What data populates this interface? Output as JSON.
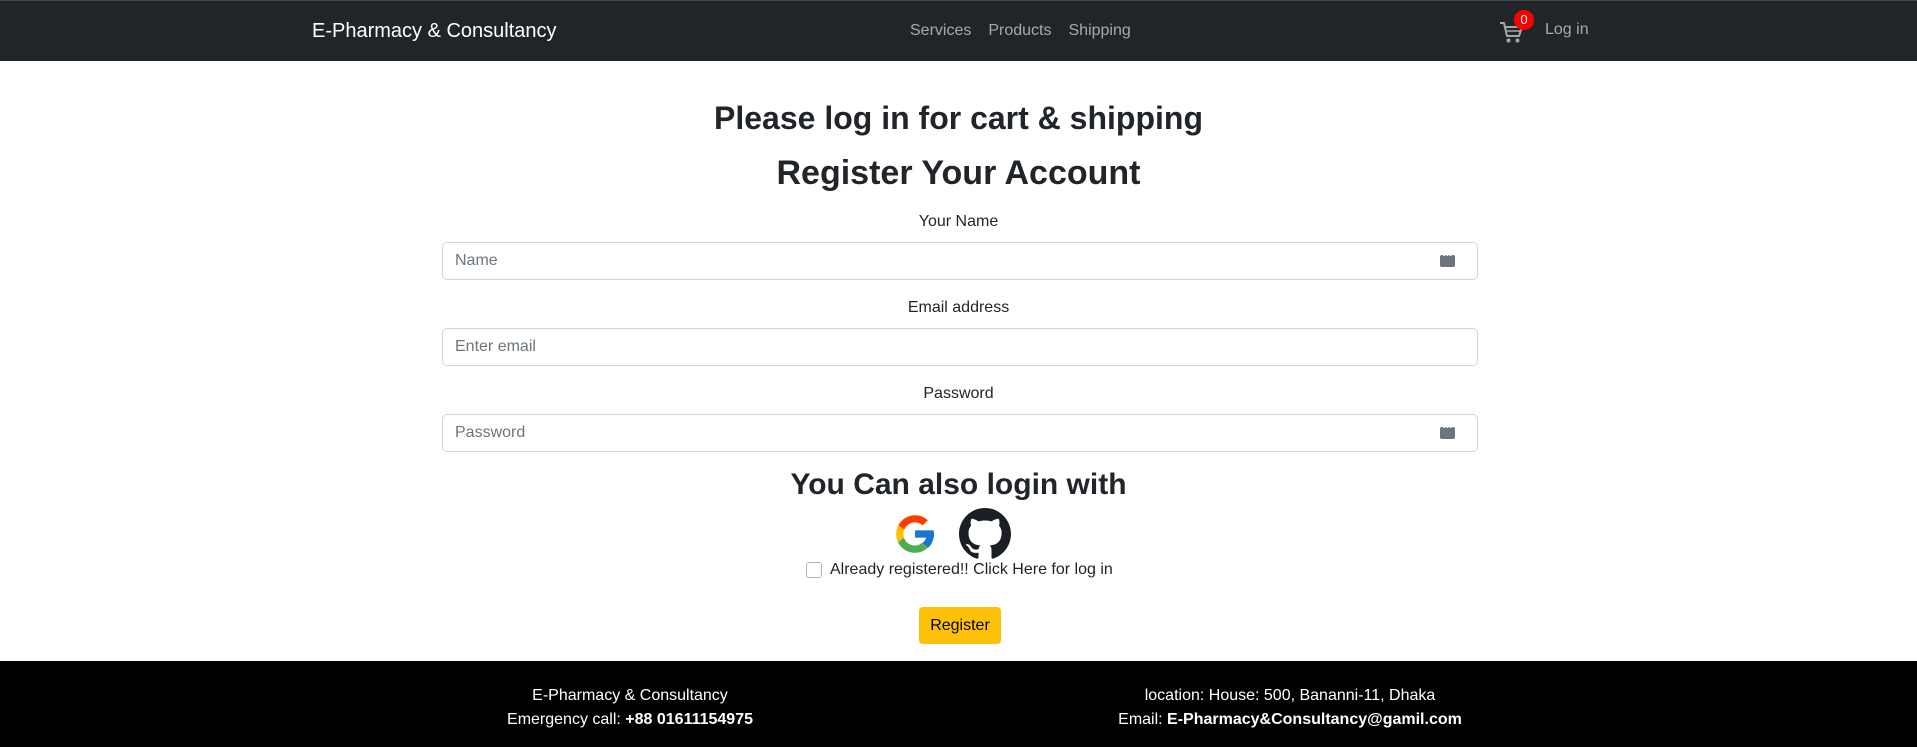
{
  "navbar": {
    "brand": "E-Pharmacy & Consultancy",
    "links": [
      "Services",
      "Products",
      "Shipping"
    ],
    "cart_count": "0",
    "login_label": "Log in"
  },
  "main": {
    "notice_title": "Please log in for cart & shipping",
    "register_title": "Register Your Account",
    "name_label": "Your Name",
    "name_placeholder": "Name",
    "email_label": "Email address",
    "email_placeholder": "Enter email",
    "password_label": "Password",
    "password_placeholder": "Password",
    "also_login_title": "You Can also login with",
    "social_providers": [
      "google-icon",
      "github-icon"
    ],
    "already_registered_label": "Already registered!! Click Here for log in",
    "register_button": "Register"
  },
  "footer": {
    "left_line1": "E-Pharmacy & Consultancy",
    "left_line2_label": "Emergency call: ",
    "left_line2_value": "+88 01611154975",
    "right_line1": "location: House: 500, Bananni-11, Dhaka",
    "right_line2_label": "Email: ",
    "right_line2_value": "E-Pharmacy&Consultancy@gamil.com"
  },
  "colors": {
    "navbar_bg": "#212529",
    "badge": "#ff0000",
    "register_button": "#ffc107",
    "footer_bg": "#000000"
  }
}
